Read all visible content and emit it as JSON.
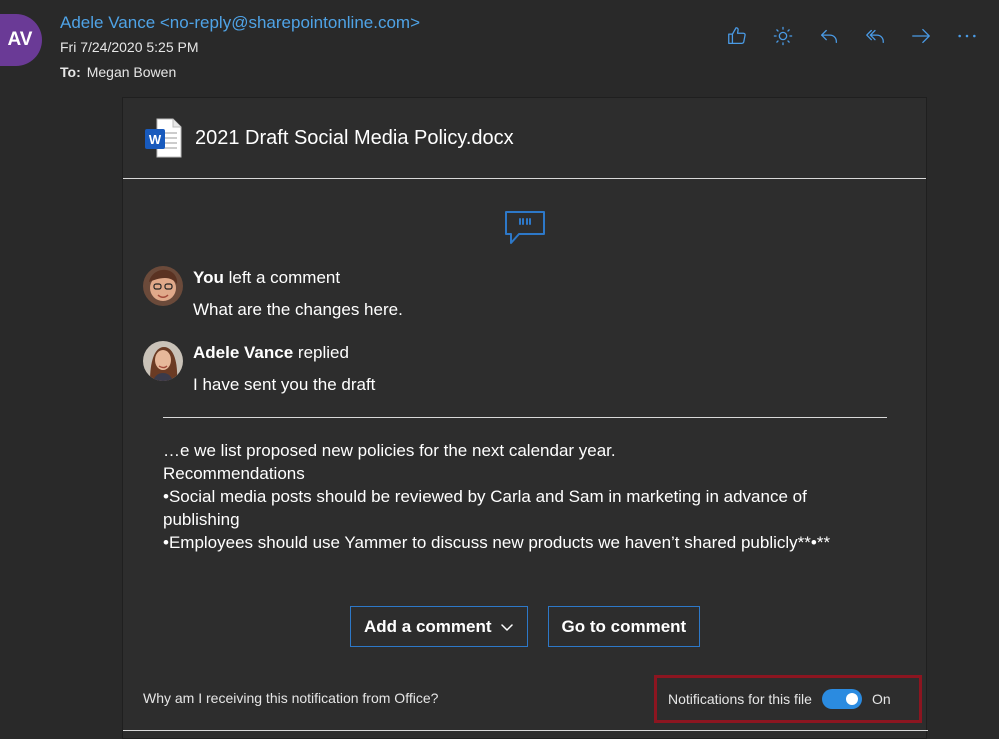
{
  "header": {
    "avatar_initials": "AV",
    "avatar_color": "#6a3a96",
    "sender": "Adele Vance <no-reply@sharepointonline.com>",
    "date": "Fri 7/24/2020 5:25 PM",
    "to_label": "To:",
    "to_value": "Megan Bowen",
    "toolbar": [
      {
        "icon": "like-icon"
      },
      {
        "icon": "sun-icon"
      },
      {
        "icon": "reply-icon"
      },
      {
        "icon": "reply-all-icon"
      },
      {
        "icon": "forward-icon"
      },
      {
        "icon": "more-icon"
      }
    ]
  },
  "card": {
    "doc_title": "2021 Draft Social Media Policy.docx",
    "doc_icon": "word-doc-icon",
    "comments": [
      {
        "author": "You",
        "action": "left a comment",
        "text": "What are the changes here."
      },
      {
        "author": "Adele Vance",
        "action": "replied",
        "text": "I have sent you the draft"
      }
    ],
    "excerpt": [
      "…e we list proposed new policies for the next calendar year.",
      "Recommendations",
      "•Social media posts should be reviewed by Carla and Sam in marketing in advance of publishing",
      "•Employees should use Yammer to discuss new products we haven’t shared publicly**•**"
    ],
    "buttons": {
      "add_comment": "Add a comment",
      "go_to_comment": "Go to comment"
    },
    "footer": {
      "why": "Why am I receiving this notification from Office?",
      "notif_label": "Notifications for this file",
      "toggle_state": "On"
    }
  },
  "colors": {
    "background": "#292929",
    "link": "#4fa3e6",
    "accent": "#2b8be0",
    "highlight_border": "#8c1520"
  }
}
